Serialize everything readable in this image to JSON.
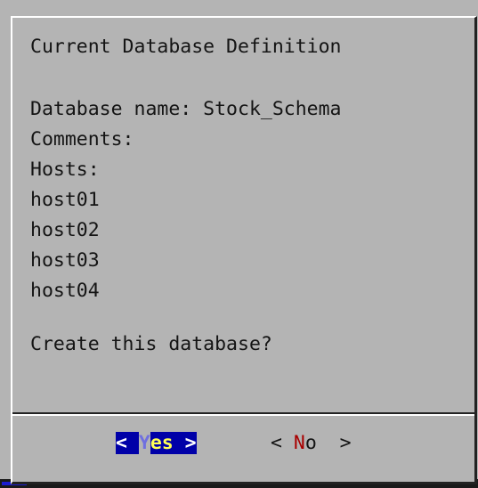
{
  "dialog": {
    "title": "Current Database Definition",
    "db_name_line": "Database name: Stock_Schema",
    "comments_line": "Comments:",
    "hosts_label": "Hosts:",
    "hosts": [
      "host01",
      "host02",
      "host03",
      "host04"
    ],
    "question": "Create this database?"
  },
  "buttons": {
    "yes": {
      "open": "< ",
      "hotkey": "Y",
      "rest": "es",
      "close": " >"
    },
    "no": {
      "open": "< ",
      "hotkey": "N",
      "rest": "o",
      "close": "  >"
    }
  },
  "colors": {
    "background": "#b4b4b4",
    "selected_button_bg": "#0000a8",
    "selected_button_text": "#ffff55",
    "hotkey_red": "#a80000"
  }
}
